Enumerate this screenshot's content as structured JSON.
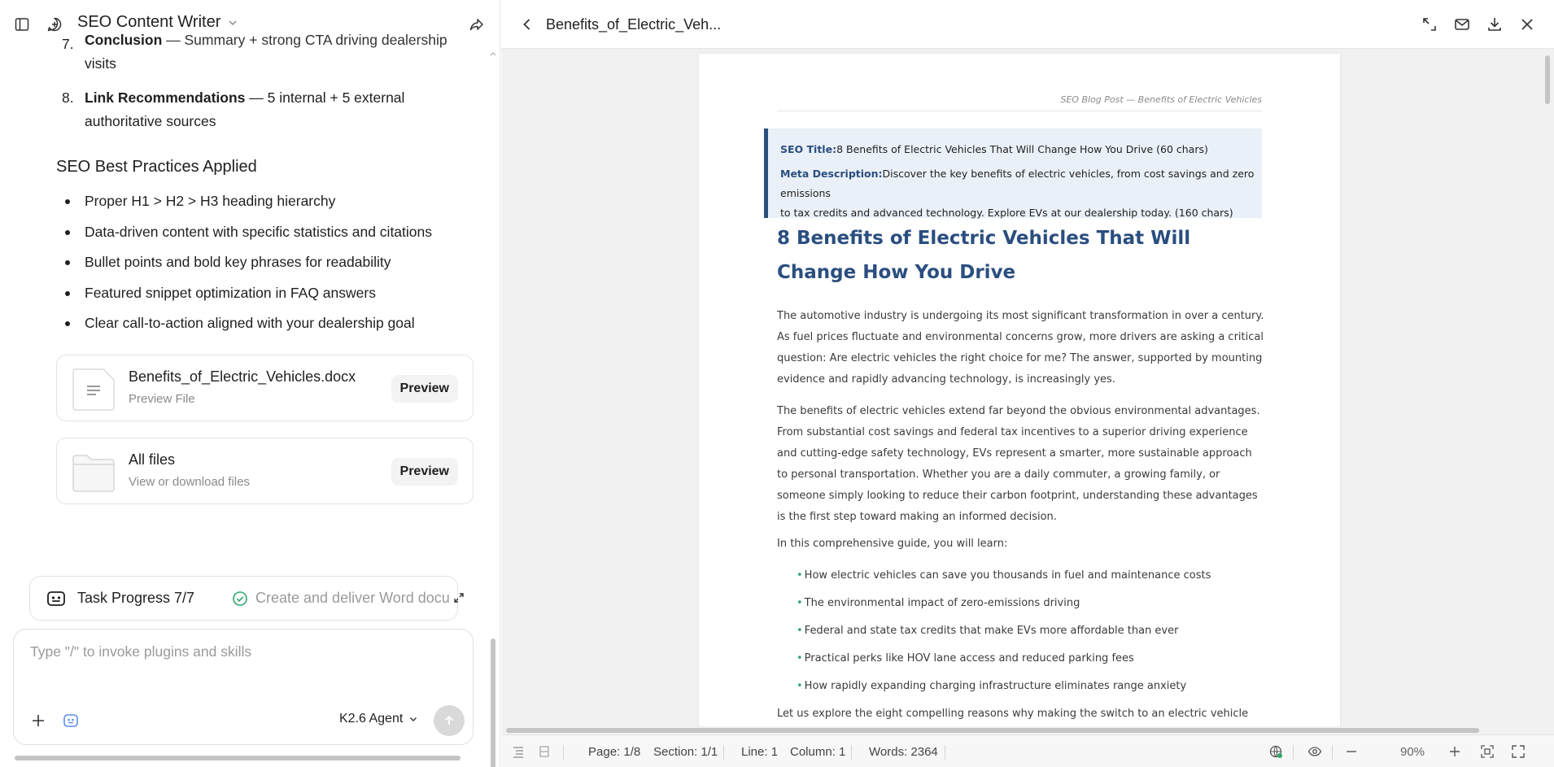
{
  "app": {
    "title": "SEO Content Writer"
  },
  "chat": {
    "list_items": [
      {
        "num": "7.",
        "bold": "Conclusion",
        "text": " — Summary + strong CTA driving dealership",
        "text2": "visits"
      },
      {
        "num": "8.",
        "bold": "Link Recommendations",
        "text": " — 5 internal + 5 external",
        "text2": "authoritative sources"
      }
    ],
    "section_heading": "SEO Best Practices Applied",
    "bullets": [
      "Proper H1 > H2 > H3 heading hierarchy",
      "Data-driven content with specific statistics and citations",
      "Bullet points and bold key phrases for readability",
      "Featured snippet optimization in FAQ answers",
      "Clear call-to-action aligned with your dealership goal"
    ],
    "file_card": {
      "name": "Benefits_of_Electric_Vehicles.docx",
      "sub": "Preview File",
      "button": "Preview"
    },
    "all_files_card": {
      "name": "All files",
      "sub": "View or download files",
      "button": "Preview"
    }
  },
  "task": {
    "label": "Task Progress 7/7",
    "step": "Create and deliver Word document"
  },
  "composer": {
    "placeholder": "Type \"/\" to invoke plugins and skills",
    "model": "K2.6 Agent"
  },
  "viewer": {
    "title": "Benefits_of_Electric_Veh...",
    "page_header": "SEO Blog Post — Benefits of Electric Vehicles",
    "seo_title_key": "SEO Title:",
    "seo_title": "8 Benefits of Electric Vehicles That Will Change How You Drive (60 chars)",
    "meta_key": "Meta Description:",
    "meta_line1": "Discover the key benefits of electric vehicles, from cost savings and zero emissions",
    "meta_line2": "to tax credits and advanced technology. Explore EVs at our dealership today. (160 chars)",
    "h1": "8 Benefits of Electric Vehicles That Will Change How You Drive",
    "para1": "The automotive industry is undergoing its most significant transformation in over a century. As fuel prices fluctuate and environmental concerns grow, more drivers are asking a critical question: Are electric vehicles the right choice for me? The answer, supported by mounting evidence and rapidly advancing technology, is increasingly yes.",
    "para2": "The benefits of electric vehicles extend far beyond the obvious environmental advantages. From substantial cost savings and federal tax incentives to a superior driving experience and cutting-edge safety technology, EVs represent a smarter, more sustainable approach to personal transportation. Whether you are a daily commuter, a growing family, or someone simply looking to reduce their carbon footprint, understanding these advantages is the first step toward making an informed decision.",
    "para3": "In this comprehensive guide, you will learn:",
    "doc_bullets": [
      "How electric vehicles can save you thousands in fuel and maintenance costs",
      "The environmental impact of zero-emissions driving",
      "Federal and state tax credits that make EVs more affordable than ever",
      "Practical perks like HOV lane access and reduced parking fees",
      "How rapidly expanding charging infrastructure eliminates range anxiety"
    ],
    "para4": "Let us explore the eight compelling reasons why making the switch to an electric vehicle"
  },
  "status": {
    "page": "Page: 1/8",
    "section": "Section: 1/1",
    "line": "Line: 1",
    "column": "Column: 1",
    "words": "Words: 2364",
    "zoom": "90%"
  },
  "colors": {
    "accent_blue": "#2a4e7f",
    "bullet_green": "#3aa876"
  }
}
